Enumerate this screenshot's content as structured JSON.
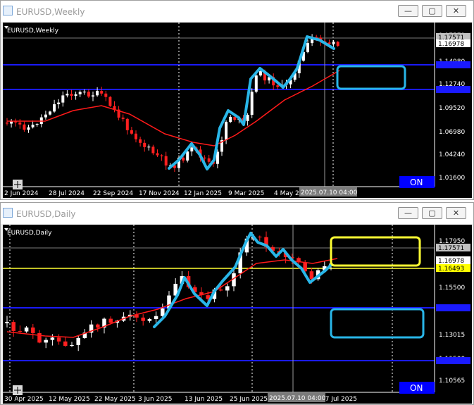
{
  "windows": [
    {
      "title": "EURUSD,Weekly",
      "symbol_label": "EURUSD,Weekly",
      "price_labels": [
        "1.17571",
        "1.16978",
        "1.14980",
        "1.12740",
        "1.09520",
        "1.06980",
        "1.04240",
        "1.01600"
      ],
      "highlight_labels": [
        {
          "text": "1.17571",
          "bg": "#c0c0c0",
          "fg": "#000000"
        },
        {
          "text": "1.16978",
          "bg": "#ffffff",
          "fg": "#000000"
        }
      ],
      "date_labels": [
        "2 Jun 2024",
        "28 Jul 2024",
        "22 Sep 2024",
        "17 Nov 2024",
        "12 Jan 2025",
        "9 Mar 2025",
        "4 May 2"
      ],
      "crosshair_time": "2025.07.10 04:00",
      "on_button": "ON"
    },
    {
      "title": "EURUSD,Daily",
      "symbol_label": "EURUSD,Daily",
      "price_labels": [
        "1.17950",
        "1.16978",
        "1.15500",
        "1.14000",
        "1.13015",
        "1.11500",
        "1.10565"
      ],
      "highlight_labels": [
        {
          "text": "1.17571",
          "bg": "#c0c0c0",
          "fg": "#000000"
        },
        {
          "text": "1.16978",
          "bg": "#ffffff",
          "fg": "#000000"
        },
        {
          "text": "1.16493",
          "bg": "#ffff00",
          "fg": "#000000"
        }
      ],
      "date_labels": [
        "30 Apr 2025",
        "12 May 2025",
        "22 May 2025",
        "3 Jun 2025",
        "13 Jun 2025",
        "25 Jun 2025",
        "17 Jul 2025"
      ],
      "crosshair_time": "2025.07.10 04:00",
      "on_button": "ON"
    }
  ],
  "colors": {
    "background": "#000000",
    "bull": "#ffffff",
    "bear": "#ff2020",
    "ma": "#ff1a1a",
    "trend": "#29b6e8",
    "hline": "#1a1aff",
    "yline": "#ffff33",
    "on_button": "#0000ff"
  },
  "icons": [
    "chart-window-icon",
    "minimize-icon",
    "maximize-icon",
    "close-icon",
    "crosshair-icon"
  ]
}
